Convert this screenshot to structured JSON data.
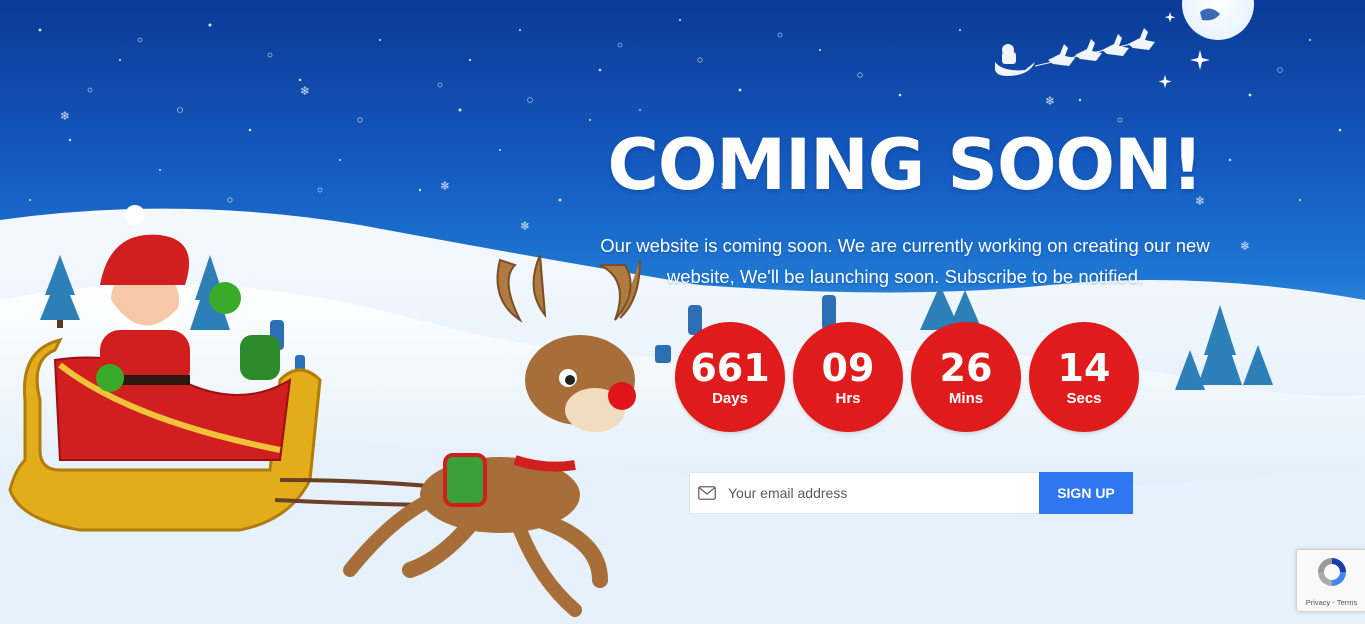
{
  "hero": {
    "title": "COMING SOON!",
    "subtitle": "Our website is coming soon. We are currently working on creating our new website, We'll be launching soon. Subscribe to be notified."
  },
  "countdown": [
    {
      "value": "661",
      "label": "Days"
    },
    {
      "value": "09",
      "label": "Hrs"
    },
    {
      "value": "26",
      "label": "Mins"
    },
    {
      "value": "14",
      "label": "Secs"
    }
  ],
  "subscribe": {
    "placeholder": "Your email address",
    "button_label": "SIGN UP"
  },
  "recaptcha": {
    "privacy": "Privacy",
    "separator": " - ",
    "terms": "Terms"
  },
  "icons": {
    "mail": "envelope-icon",
    "recaptcha": "recaptcha-logo-icon"
  },
  "colors": {
    "sky_top": "#0c3e9c",
    "sky_mid": "#1d6fd0",
    "snow": "#eaf4fc",
    "countdown_red": "#e01b1b",
    "signup_blue": "#2f77f0",
    "title_white": "#ffffff"
  }
}
